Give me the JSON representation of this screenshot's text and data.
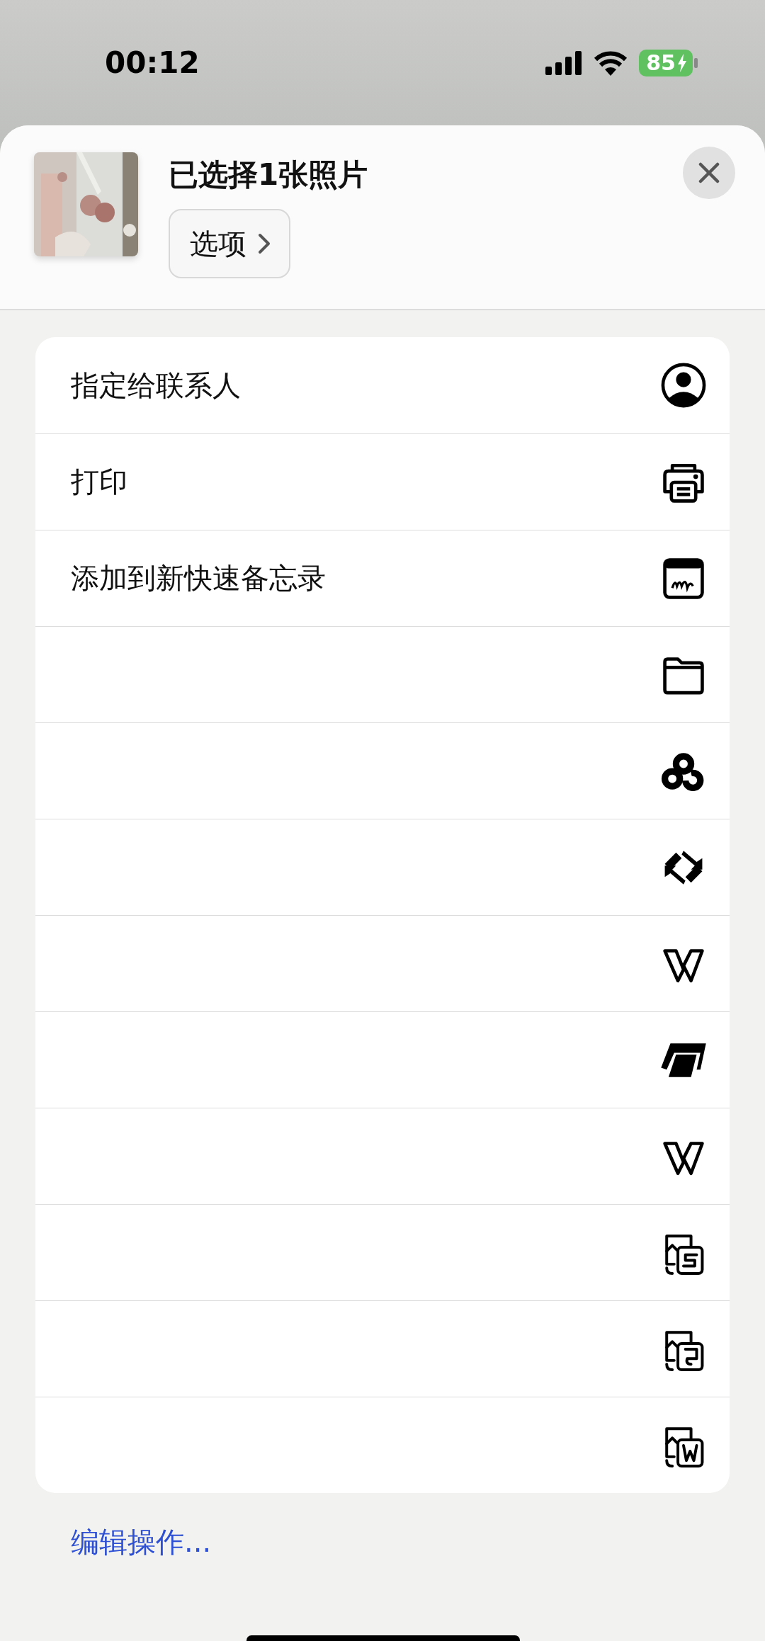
{
  "status_bar": {
    "time": "00:12",
    "battery": "85"
  },
  "share_header": {
    "title": "已选择1张照片",
    "options_button": "选项"
  },
  "actions": [
    {
      "label": "指定给联系人",
      "kind": "contact"
    },
    {
      "label": "打印",
      "kind": "printer"
    },
    {
      "label": "添加到新快速备忘录",
      "kind": "note"
    },
    {
      "kind": "folder"
    },
    {
      "kind": "cloud"
    },
    {
      "kind": "swirl"
    },
    {
      "kind": "w"
    },
    {
      "kind": "slant"
    },
    {
      "kind": "w"
    },
    {
      "kind": "photo-s"
    },
    {
      "kind": "photo-p"
    },
    {
      "kind": "photo-w"
    }
  ],
  "edit_actions_link": "编辑操作..."
}
